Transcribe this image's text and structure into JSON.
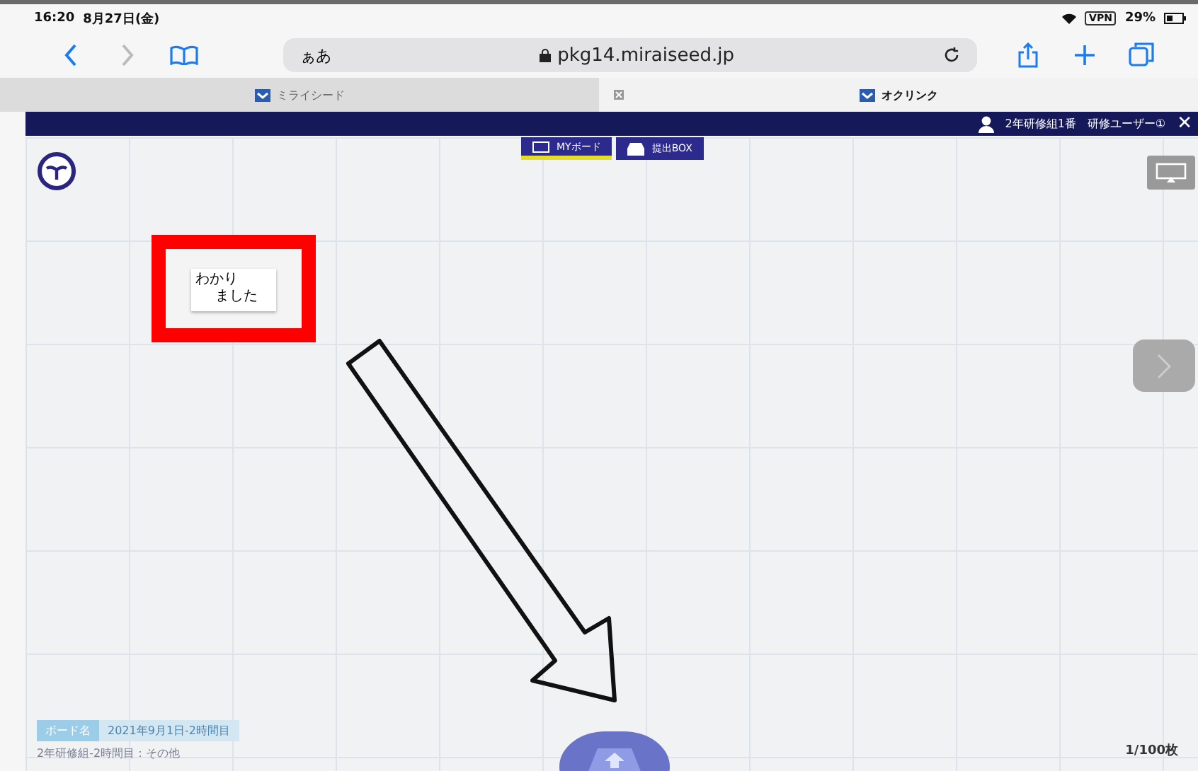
{
  "status_bar": {
    "time": "16:20",
    "date": "8月27日(金)",
    "vpn": "VPN",
    "battery": "29%"
  },
  "browser": {
    "text_size": "ぁあ",
    "url": "pkg14.miraiseed.jp"
  },
  "browser_tabs": [
    {
      "label": "ミライシード",
      "selected": false,
      "closable": false
    },
    {
      "label": "オクリンク",
      "selected": true,
      "closable": true
    }
  ],
  "app_bar": {
    "class": "2年研修組1番",
    "user": "研修ユーザー①",
    "close": "✕"
  },
  "board_tabs": [
    {
      "label": "MYボード",
      "kind": "board",
      "selected": true
    },
    {
      "label": "提出BOX",
      "kind": "box",
      "selected": false
    }
  ],
  "card": {
    "lines": [
      "わかり",
      "ました"
    ]
  },
  "board_info": {
    "tag": "ボード名",
    "name": "2021年9月1日-2時間目",
    "subtitle": "2年研修組-2時間目：その他"
  },
  "page_count": "1/100枚"
}
